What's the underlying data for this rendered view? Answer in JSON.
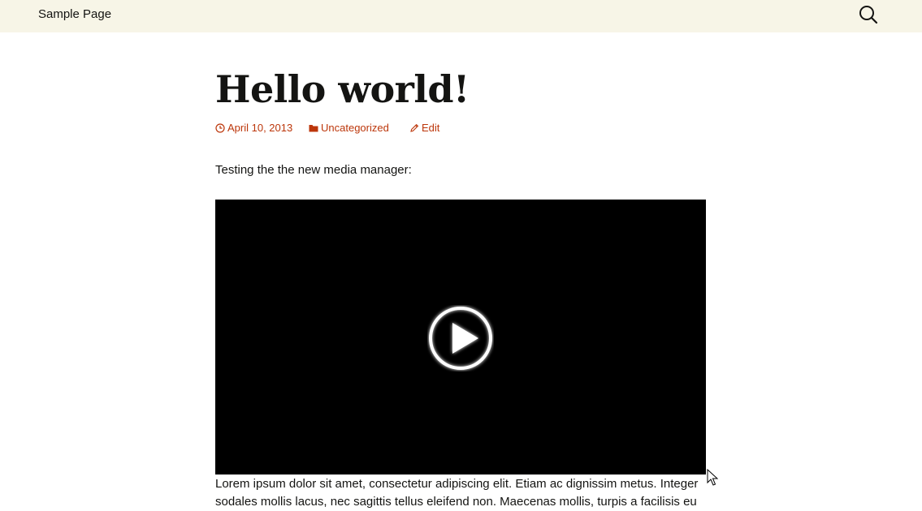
{
  "header": {
    "nav_label": "Sample Page",
    "search_icon": "search-icon"
  },
  "post": {
    "title": "Hello world!",
    "meta": {
      "date": "April 10, 2013",
      "category": "Uncategorized",
      "edit": "Edit"
    },
    "intro": "Testing the the new media manager:",
    "video": {
      "play_icon": "play-icon"
    },
    "body": "Lorem ipsum dolor sit amet, consectetur adipiscing elit. Etiam ac dignissim metus. Integer sodales mollis lacus, nec sagittis tellus eleifend non. Maecenas mollis, turpis a facilisis eu"
  },
  "colors": {
    "header_bg": "#f7f5e7",
    "link_accent": "#bc360a",
    "text": "#141412",
    "video_bg": "#000000"
  }
}
